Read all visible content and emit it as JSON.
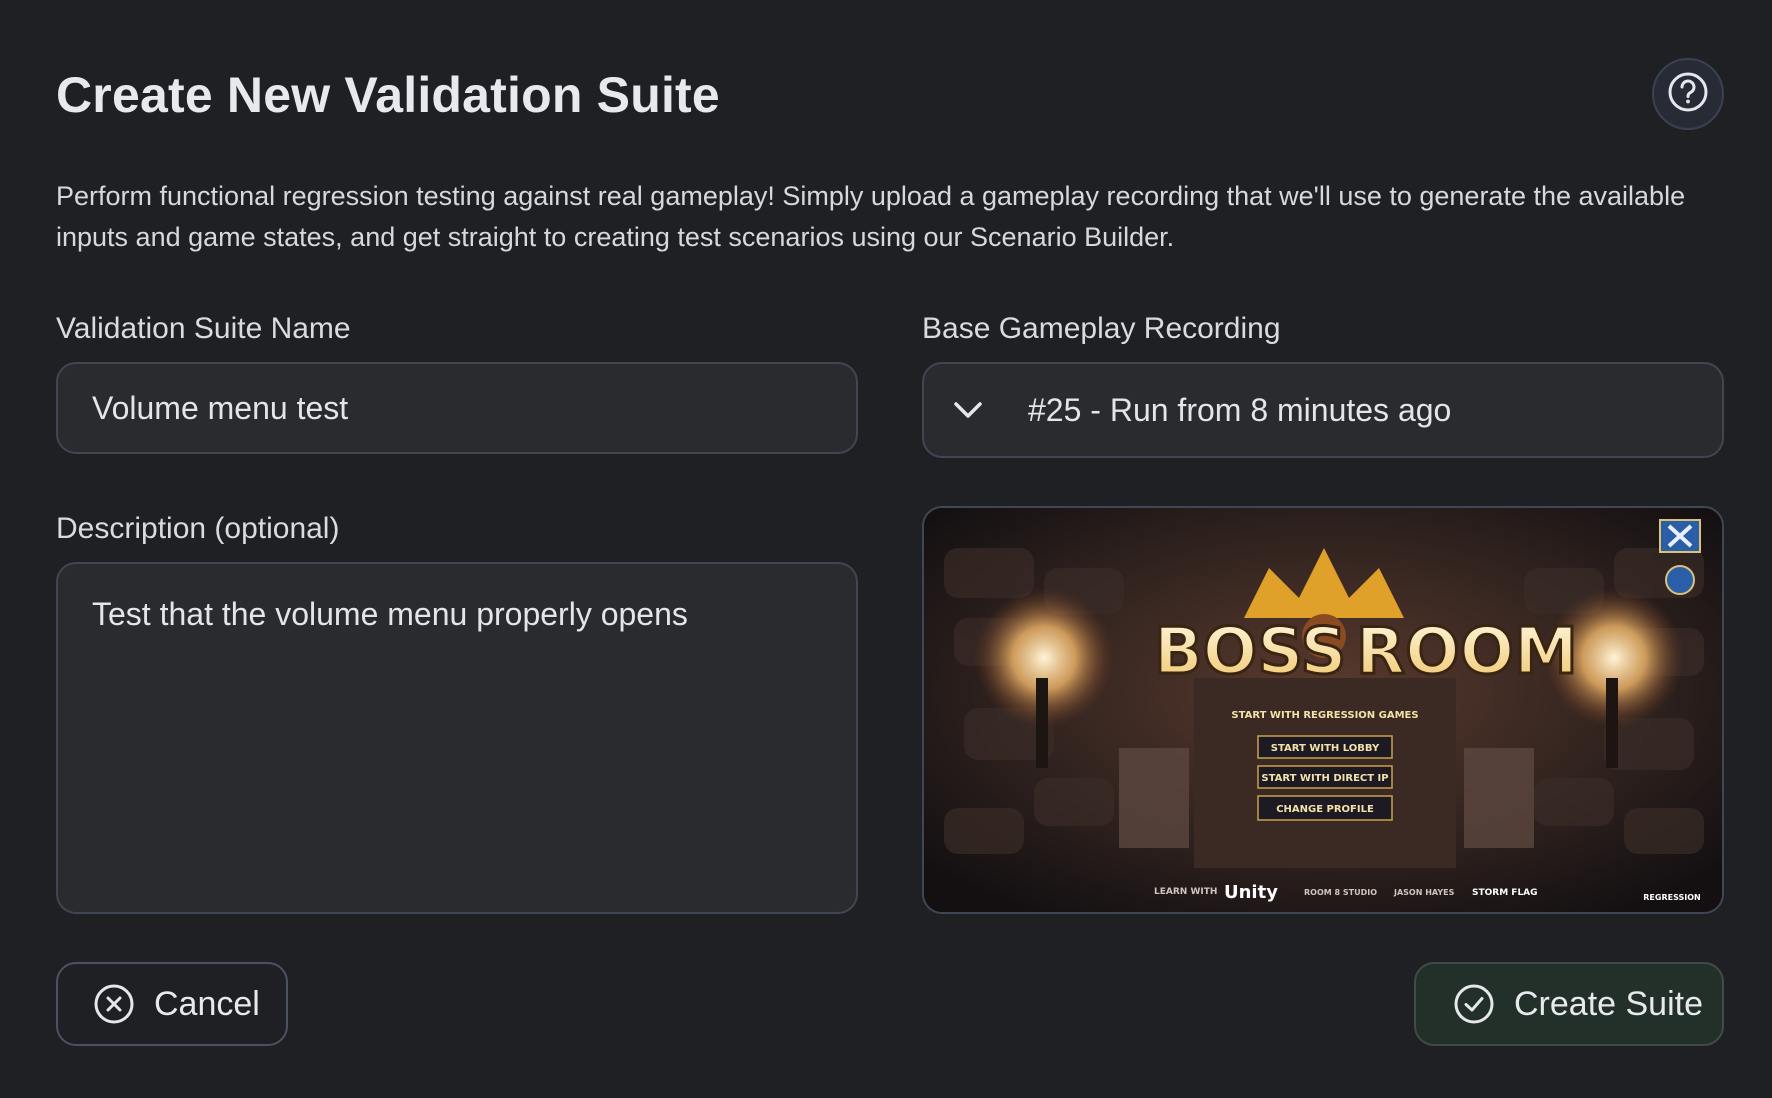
{
  "dialog": {
    "title": "Create New Validation Suite",
    "description": "Perform functional regression testing against real gameplay! Simply upload a gameplay recording that we'll use to generate the available inputs and game states, and get straight to creating test scenarios using our Scenario Builder."
  },
  "form": {
    "name_label": "Validation Suite Name",
    "name_value": "Volume menu test",
    "description_label": "Description (optional)",
    "description_value": "Test that the volume menu properly opens",
    "recording_label": "Base Gameplay Recording",
    "recording_value": "#25 - Run from 8 minutes ago"
  },
  "preview": {
    "game_title_left": "BOSS",
    "game_title_right": "ROOM",
    "menu_items": [
      "START WITH REGRESSION GAMES",
      "START WITH LOBBY",
      "START WITH DIRECT IP",
      "CHANGE PROFILE"
    ],
    "footer_learn": "LEARN WITH",
    "footer_unity": "Unity",
    "footer_studio": "ROOM 8 STUDIO",
    "footer_jason": "JASON HAYES",
    "footer_storm": "STORM FLAG",
    "corner_logo": "REGRESSION"
  },
  "actions": {
    "cancel_label": "Cancel",
    "create_label": "Create Suite"
  },
  "colors": {
    "background": "#1f2023",
    "field_bg": "#2a2b2e",
    "field_border": "#3f4654",
    "create_bg": "#223029"
  },
  "icons": {
    "help": "help-circle-icon",
    "chevron": "chevron-down-icon",
    "cancel": "x-circle-icon",
    "create": "check-circle-icon"
  }
}
